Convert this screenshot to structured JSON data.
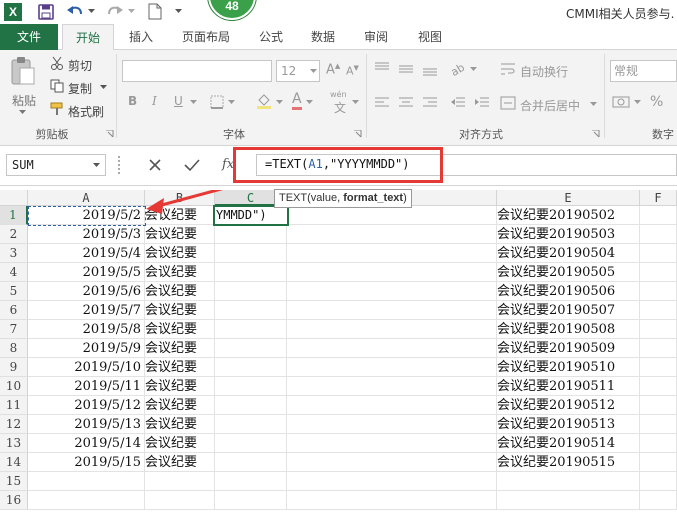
{
  "app": {
    "title": "CMMI相关人员参与.",
    "badge": "48",
    "logo_letter": "X"
  },
  "tabs": [
    {
      "label": "文件"
    },
    {
      "label": "开始"
    },
    {
      "label": "插入"
    },
    {
      "label": "页面布局"
    },
    {
      "label": "公式"
    },
    {
      "label": "数据"
    },
    {
      "label": "审阅"
    },
    {
      "label": "视图"
    }
  ],
  "ribbon": {
    "clipboard": {
      "paste": "粘贴",
      "cut": "剪切",
      "copy": "复制",
      "format_painter": "格式刷",
      "group": "剪贴板"
    },
    "font": {
      "size": "12",
      "bold": "B",
      "italic": "I",
      "underline": "U",
      "phonetic": "wén",
      "group": "字体"
    },
    "alignment": {
      "wrap": "自动换行",
      "merge": "合并后居中",
      "group": "对齐方式"
    },
    "number": {
      "format": "常规",
      "percent": "%",
      "group": "数字"
    }
  },
  "formula_bar": {
    "name_box": "SUM",
    "formula": "=TEXT(A1,\"YYYYMMDD\")",
    "formula_prefix": "=TEXT(",
    "formula_ref": "A1",
    "formula_suffix": ",\"YYYYMMDD\")",
    "fx": "fx"
  },
  "tooltip": {
    "func": "TEXT(value, ",
    "arg": "format_text",
    "close": ")"
  },
  "columns": [
    "A",
    "B",
    "C",
    "D",
    "E",
    "F"
  ],
  "rows": [
    "1",
    "2",
    "3",
    "4",
    "5",
    "6",
    "7",
    "8",
    "9",
    "10",
    "11",
    "12",
    "13",
    "14",
    "15",
    "16"
  ],
  "sheet": {
    "col_a": [
      "2019/5/2",
      "2019/5/3",
      "2019/5/4",
      "2019/5/5",
      "2019/5/6",
      "2019/5/7",
      "2019/5/8",
      "2019/5/9",
      "2019/5/10",
      "2019/5/11",
      "2019/5/12",
      "2019/5/13",
      "2019/5/14",
      "2019/5/15"
    ],
    "col_b": "会议纪要",
    "c1_edit": "YMMDD\")",
    "col_e": [
      "会议纪要20190502",
      "会议纪要20190503",
      "会议纪要20190504",
      "会议纪要20190505",
      "会议纪要20190506",
      "会议纪要20190507",
      "会议纪要20190508",
      "会议纪要20190509",
      "会议纪要20190510",
      "会议纪要20190511",
      "会议纪要20190512",
      "会议纪要20190513",
      "会议纪要20190514",
      "会议纪要20190515"
    ]
  },
  "colors": {
    "excel_green": "#217346",
    "annotation_red": "#e53935",
    "ref_blue": "#2f5ea8",
    "badge_green": "#3aa04a"
  }
}
